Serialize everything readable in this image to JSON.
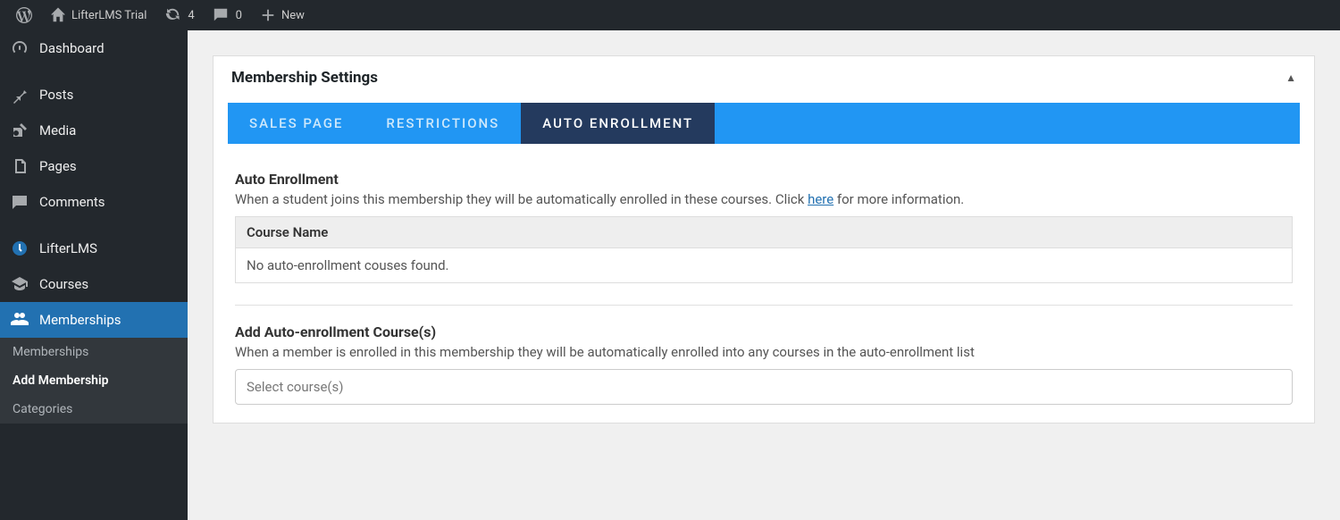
{
  "adminbar": {
    "site_name": "LifterLMS Trial",
    "updates_count": "4",
    "comments_count": "0",
    "new_label": "New"
  },
  "sidebar": {
    "items": [
      {
        "label": "Dashboard"
      },
      {
        "label": "Posts"
      },
      {
        "label": "Media"
      },
      {
        "label": "Pages"
      },
      {
        "label": "Comments"
      },
      {
        "label": "LifterLMS"
      },
      {
        "label": "Courses"
      },
      {
        "label": "Memberships"
      }
    ],
    "submenu": [
      {
        "label": "Memberships"
      },
      {
        "label": "Add Membership"
      },
      {
        "label": "Categories"
      }
    ]
  },
  "metabox": {
    "title": "Membership Settings",
    "tabs": [
      {
        "label": "SALES PAGE"
      },
      {
        "label": "RESTRICTIONS"
      },
      {
        "label": "AUTO ENROLLMENT"
      }
    ],
    "auto_enroll": {
      "heading": "Auto Enrollment",
      "desc_pre": "When a student joins this membership they will be automatically enrolled in these courses. Click ",
      "desc_link": "here",
      "desc_post": " for more information.",
      "table_header": "Course Name",
      "table_empty": "No auto-enrollment couses found."
    },
    "add_course": {
      "heading": "Add Auto-enrollment Course(s)",
      "desc": "When a member is enrolled in this membership they will be automatically enrolled into any courses in the auto-enrollment list",
      "placeholder": "Select course(s)"
    }
  }
}
